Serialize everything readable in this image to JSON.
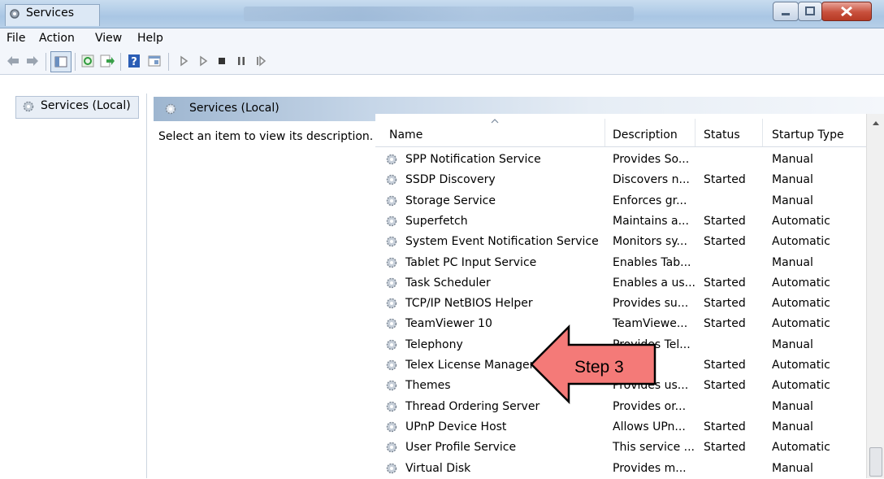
{
  "window": {
    "title": "Services"
  },
  "menu": [
    "File",
    "Action",
    "View",
    "Help"
  ],
  "toolbar_icons": [
    "back-arrow-icon",
    "forward-arrow-icon",
    "console-tree-icon",
    "refresh-icon",
    "export-list-icon",
    "help-icon",
    "properties-icon",
    "start-icon",
    "start-alt-icon",
    "stop-icon",
    "pause-icon",
    "restart-icon"
  ],
  "left_pane": {
    "item": "Services (Local)"
  },
  "right_pane": {
    "title": "Services (Local)",
    "description": "Select an item to view its description."
  },
  "columns": [
    "Name",
    "Description",
    "Status",
    "Startup Type"
  ],
  "rows": [
    {
      "name": "SPP Notification Service",
      "description": "Provides So...",
      "status": "",
      "startup": "Manual"
    },
    {
      "name": "SSDP Discovery",
      "description": "Discovers n...",
      "status": "Started",
      "startup": "Manual"
    },
    {
      "name": "Storage Service",
      "description": "Enforces gr...",
      "status": "",
      "startup": "Manual"
    },
    {
      "name": "Superfetch",
      "description": "Maintains a...",
      "status": "Started",
      "startup": "Automatic"
    },
    {
      "name": "System Event Notification Service",
      "description": "Monitors sy...",
      "status": "Started",
      "startup": "Automatic"
    },
    {
      "name": "Tablet PC Input Service",
      "description": "Enables Tab...",
      "status": "",
      "startup": "Manual"
    },
    {
      "name": "Task Scheduler",
      "description": "Enables a us...",
      "status": "Started",
      "startup": "Automatic"
    },
    {
      "name": "TCP/IP NetBIOS Helper",
      "description": "Provides su...",
      "status": "Started",
      "startup": "Automatic"
    },
    {
      "name": "TeamViewer 10",
      "description": "TeamViewe...",
      "status": "Started",
      "startup": "Automatic"
    },
    {
      "name": "Telephony",
      "description": "Provides Tel...",
      "status": "",
      "startup": "Manual"
    },
    {
      "name": "Telex License Manager",
      "description": "",
      "status": "Started",
      "startup": "Automatic"
    },
    {
      "name": "Themes",
      "description": "Provides us...",
      "status": "Started",
      "startup": "Automatic"
    },
    {
      "name": "Thread Ordering Server",
      "description": "Provides or...",
      "status": "",
      "startup": "Manual"
    },
    {
      "name": "UPnP Device Host",
      "description": "Allows UPn...",
      "status": "Started",
      "startup": "Manual"
    },
    {
      "name": "User Profile Service",
      "description": "This service ...",
      "status": "Started",
      "startup": "Automatic"
    },
    {
      "name": "Virtual Disk",
      "description": "Provides m...",
      "status": "",
      "startup": "Manual"
    }
  ],
  "callout": {
    "text": "Step 3",
    "color": "#f47a78"
  }
}
